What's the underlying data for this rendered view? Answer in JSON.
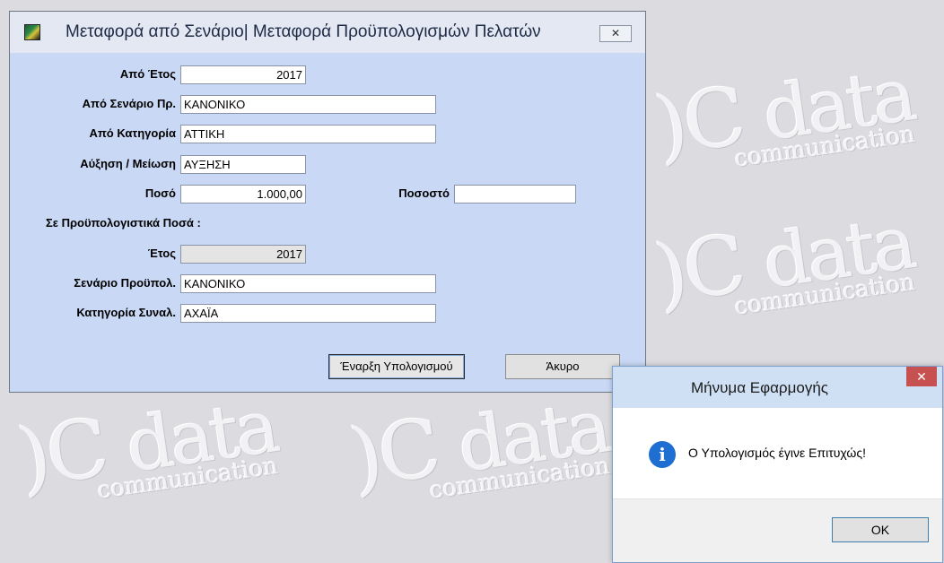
{
  "watermark": {
    "logo_text": "data",
    "sub_text": "communication"
  },
  "form": {
    "title": "Μεταφορά από Σενάριο| Μεταφορά Προϋπολογισμών Πελατών",
    "close_glyph": "✕",
    "icon": "app-icon",
    "from_year": {
      "label": "Από Έτος",
      "value": "2017"
    },
    "from_scenario": {
      "label": "Από Σενάριο Πρ.",
      "value": "ΚΑΝΟΝΙΚΟ"
    },
    "from_category": {
      "label": "Από Κατηγορία",
      "value": "ΑΤΤΙΚΗ"
    },
    "increase_decrease": {
      "label": "Αύξηση / Μείωση",
      "value": "ΑΥΞΗΣΗ"
    },
    "amount": {
      "label": "Ποσό",
      "value": "1.000,00"
    },
    "percentage": {
      "label": "Ποσοστό",
      "value": ""
    },
    "section_label": "Σε Προϋπολογιστικά Ποσά :",
    "year": {
      "label": "Έτος",
      "value": "2017"
    },
    "budget_scenario": {
      "label": "Σενάριο Προϋπολ.",
      "value": "ΚΑΝΟΝΙΚΟ"
    },
    "trans_category": {
      "label": "Κατηγορία Συναλ.",
      "value": "ΑΧΑΪΑ"
    },
    "start_button": "Έναρξη Υπολογισμού",
    "cancel_button": "Άκυρο"
  },
  "message_box": {
    "title": "Μήνυμα Εφαρμογής",
    "close_glyph": "✕",
    "icon": "info-icon",
    "text": "Ο Υπολογισμός έγινε Επιτυχώς!",
    "ok_button": "OK"
  },
  "colors": {
    "form_background": "#c9d8f4",
    "mdi_background": "#dcdce0",
    "close_button_red": "#c75050",
    "info_icon_blue": "#1e6fd1"
  }
}
